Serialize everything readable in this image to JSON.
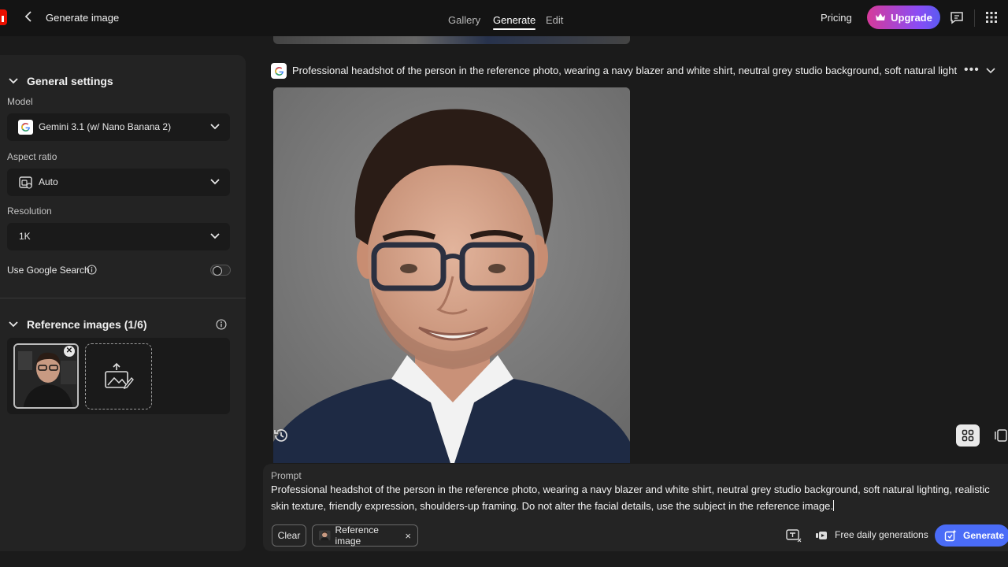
{
  "header": {
    "title": "Generate image",
    "nav": [
      "Gallery",
      "Generate",
      "Edit"
    ],
    "pricing": "Pricing",
    "upgrade": "Upgrade"
  },
  "sidebar": {
    "general_settings": "General settings",
    "model_label": "Model",
    "model_value": "Gemini 3.1 (w/ Nano Banana 2)",
    "aspect_label": "Aspect ratio",
    "aspect_value": "Auto",
    "resolution_label": "Resolution",
    "resolution_value": "1K",
    "google_search_label": "Use Google Search",
    "google_search_enabled": false,
    "reference_images": "Reference images (1/6)"
  },
  "main": {
    "generation_prompt": "Professional headshot of the person in the reference photo, wearing a navy blazer and white shirt, neutral grey studio background, soft natural lightin"
  },
  "prompt_panel": {
    "label": "Prompt",
    "text": "Professional headshot of the person in the reference photo, wearing a navy blazer and white shirt, neutral grey studio background, soft natural lighting, realistic skin texture, friendly expression, shoulders-up framing. Do not alter the facial details, use the subject in the reference image.",
    "clear": "Clear",
    "reference_chip": "Reference image",
    "free_daily": "Free daily generations",
    "generate": "Generate"
  },
  "colors": {
    "accent_blue": "#4a6cf7",
    "brand_red": "#eb1000",
    "upgrade_gradient_start": "#d63a9a",
    "upgrade_gradient_end": "#5b5bf0"
  }
}
